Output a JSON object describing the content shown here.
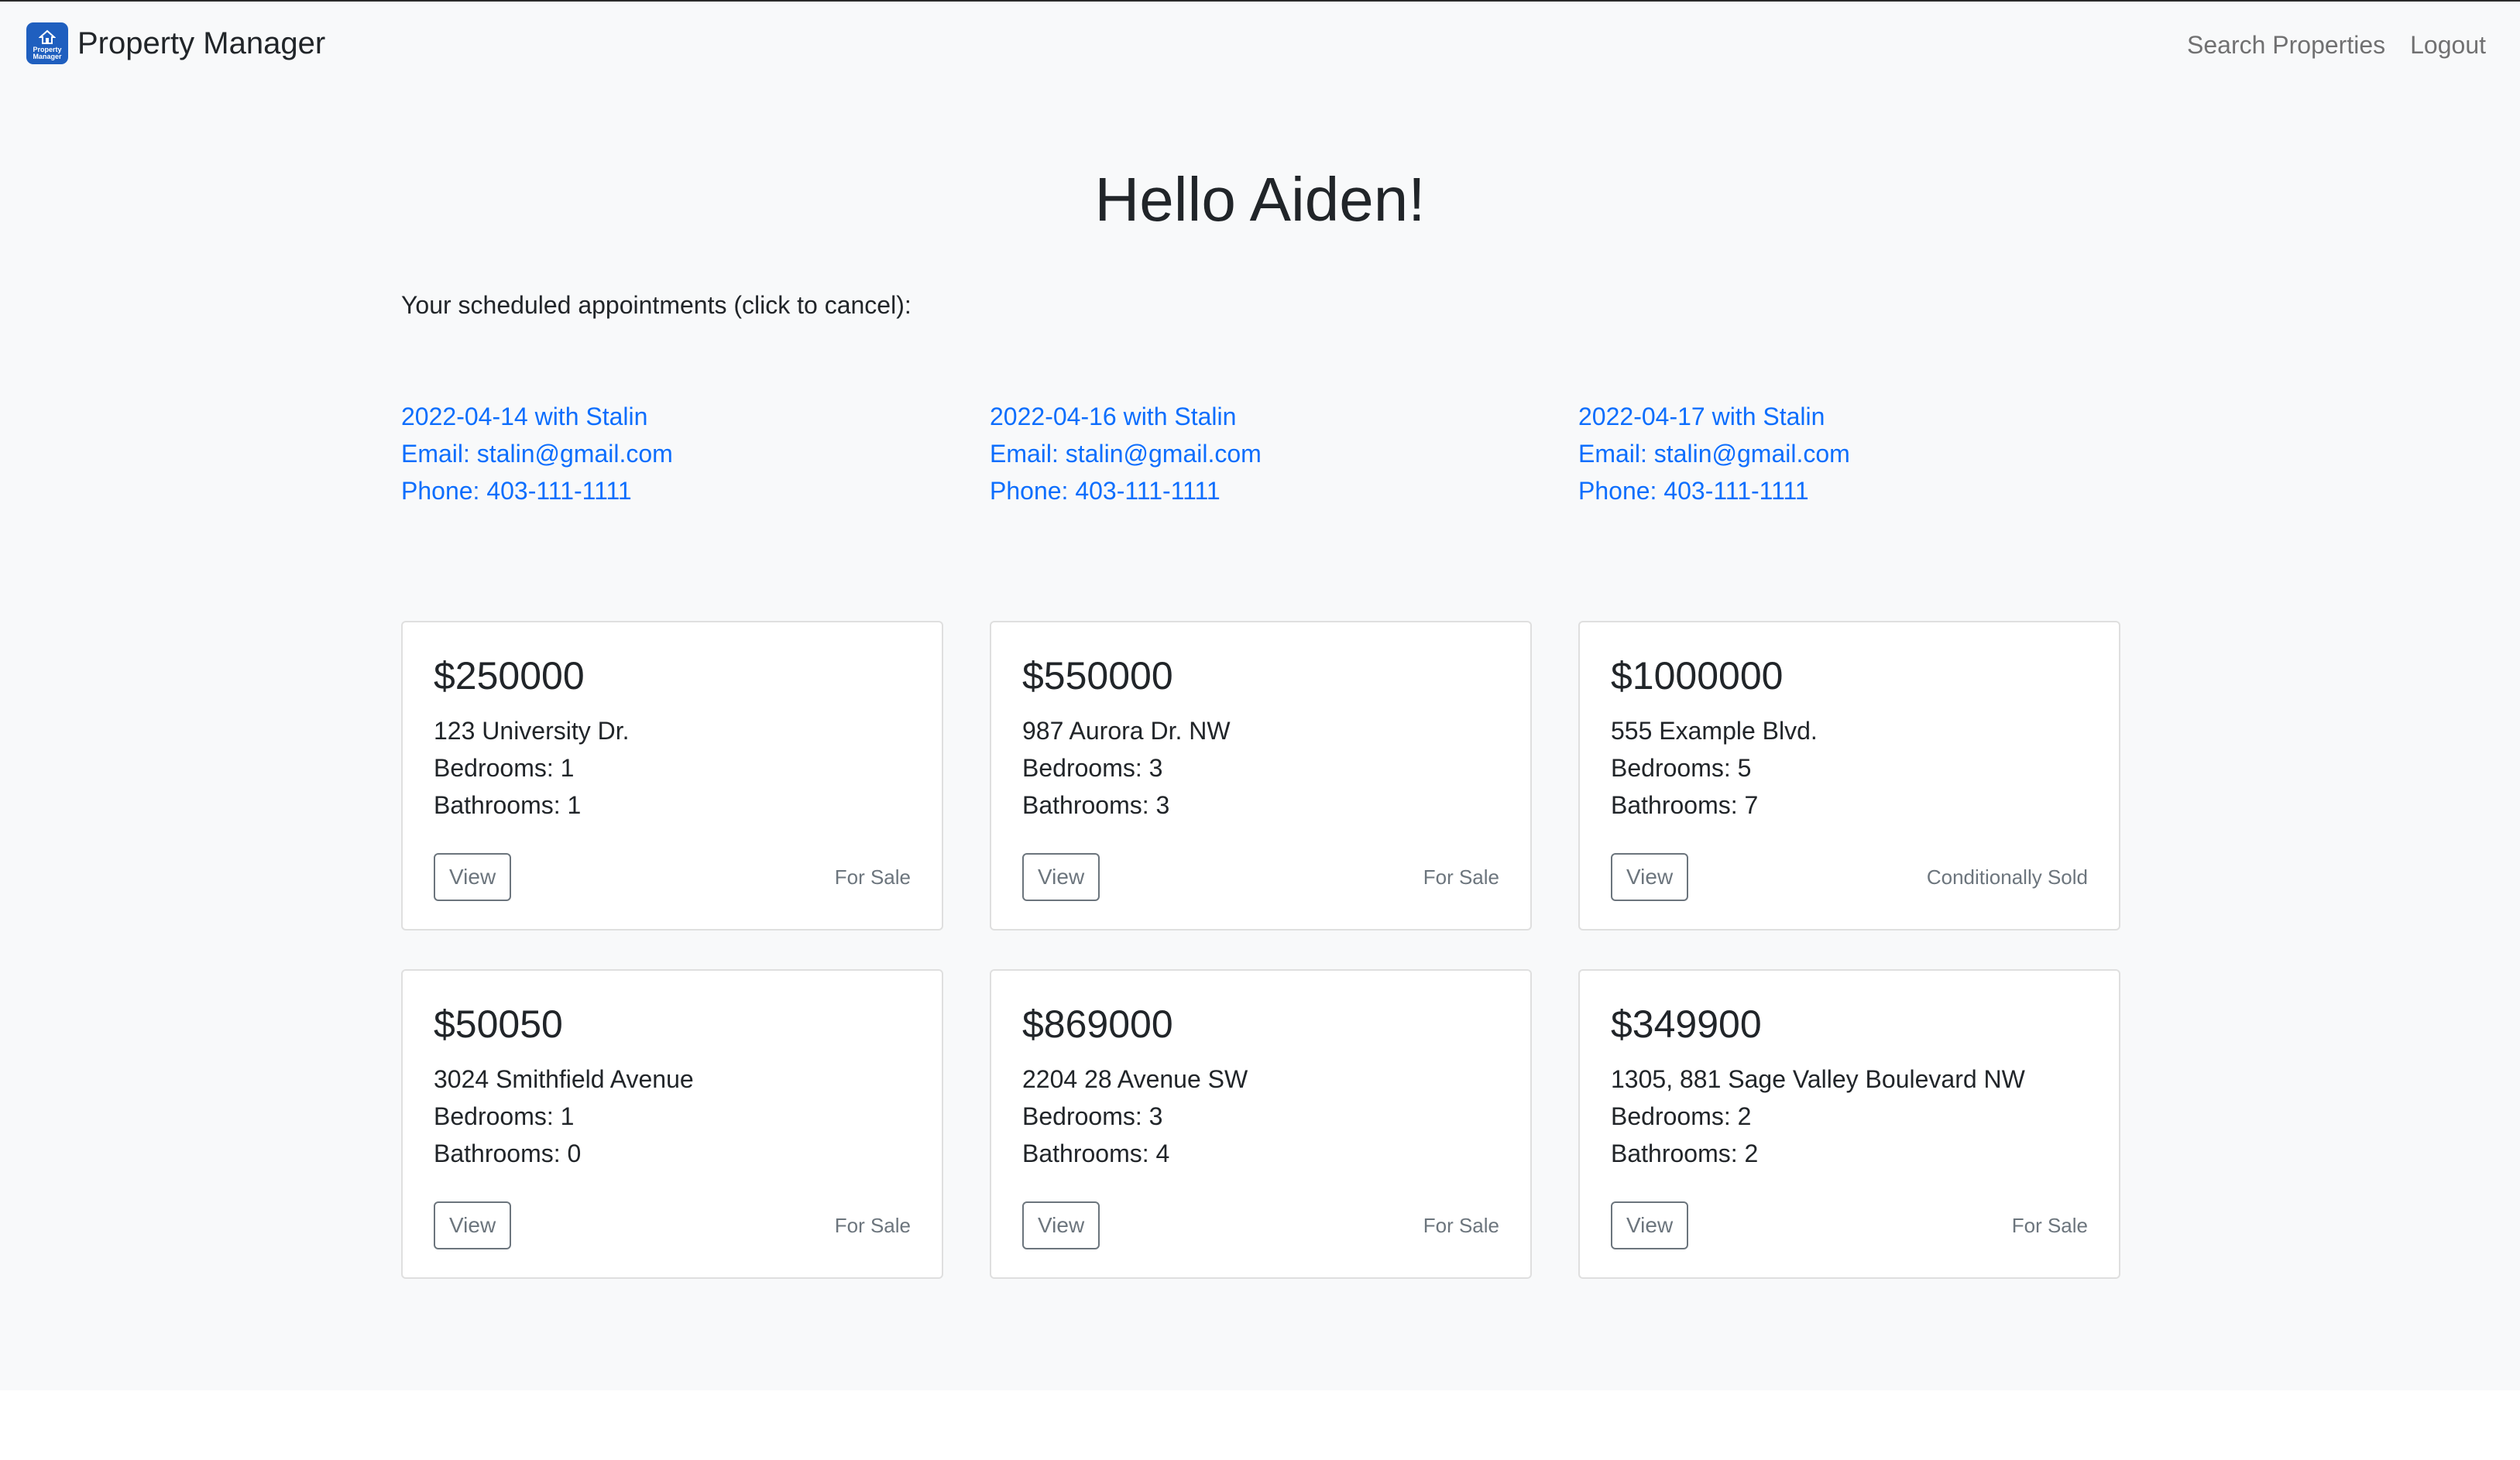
{
  "navbar": {
    "brand_name": "Property Manager",
    "logo_text_line1": "Property",
    "logo_text_line2": "Manager",
    "links": [
      "Search Properties",
      "Logout"
    ]
  },
  "greeting": "Hello Aiden!",
  "appointments_intro": "Your scheduled appointments (click to cancel):",
  "appointments": [
    {
      "title": "2022-04-14 with Stalin",
      "email": "Email: stalin@gmail.com",
      "phone": "Phone: 403-111-1111"
    },
    {
      "title": "2022-04-16 with Stalin",
      "email": "Email: stalin@gmail.com",
      "phone": "Phone: 403-111-1111"
    },
    {
      "title": "2022-04-17 with Stalin",
      "email": "Email: stalin@gmail.com",
      "phone": "Phone: 403-111-1111"
    }
  ],
  "view_label": "View",
  "properties": [
    {
      "price": "$250000",
      "address": "123 University Dr.",
      "bedrooms": "Bedrooms: 1",
      "bathrooms": "Bathrooms: 1",
      "status": "For Sale"
    },
    {
      "price": "$550000",
      "address": "987 Aurora Dr. NW",
      "bedrooms": "Bedrooms: 3",
      "bathrooms": "Bathrooms: 3",
      "status": "For Sale"
    },
    {
      "price": "$1000000",
      "address": "555 Example Blvd.",
      "bedrooms": "Bedrooms: 5",
      "bathrooms": "Bathrooms: 7",
      "status": "Conditionally Sold"
    },
    {
      "price": "$50050",
      "address": "3024 Smithfield Avenue",
      "bedrooms": "Bedrooms: 1",
      "bathrooms": "Bathrooms: 0",
      "status": "For Sale"
    },
    {
      "price": "$869000",
      "address": "2204 28 Avenue SW",
      "bedrooms": "Bedrooms: 3",
      "bathrooms": "Bathrooms: 4",
      "status": "For Sale"
    },
    {
      "price": "$349900",
      "address": "1305, 881 Sage Valley Boulevard NW",
      "bedrooms": "Bedrooms: 2",
      "bathrooms": "Bathrooms: 2",
      "status": "For Sale"
    }
  ],
  "colors": {
    "link_blue": "#0d6efd",
    "logo_blue": "#1f5fbf",
    "page_background": "#f8f9fa",
    "muted_text": "#6c757d"
  }
}
